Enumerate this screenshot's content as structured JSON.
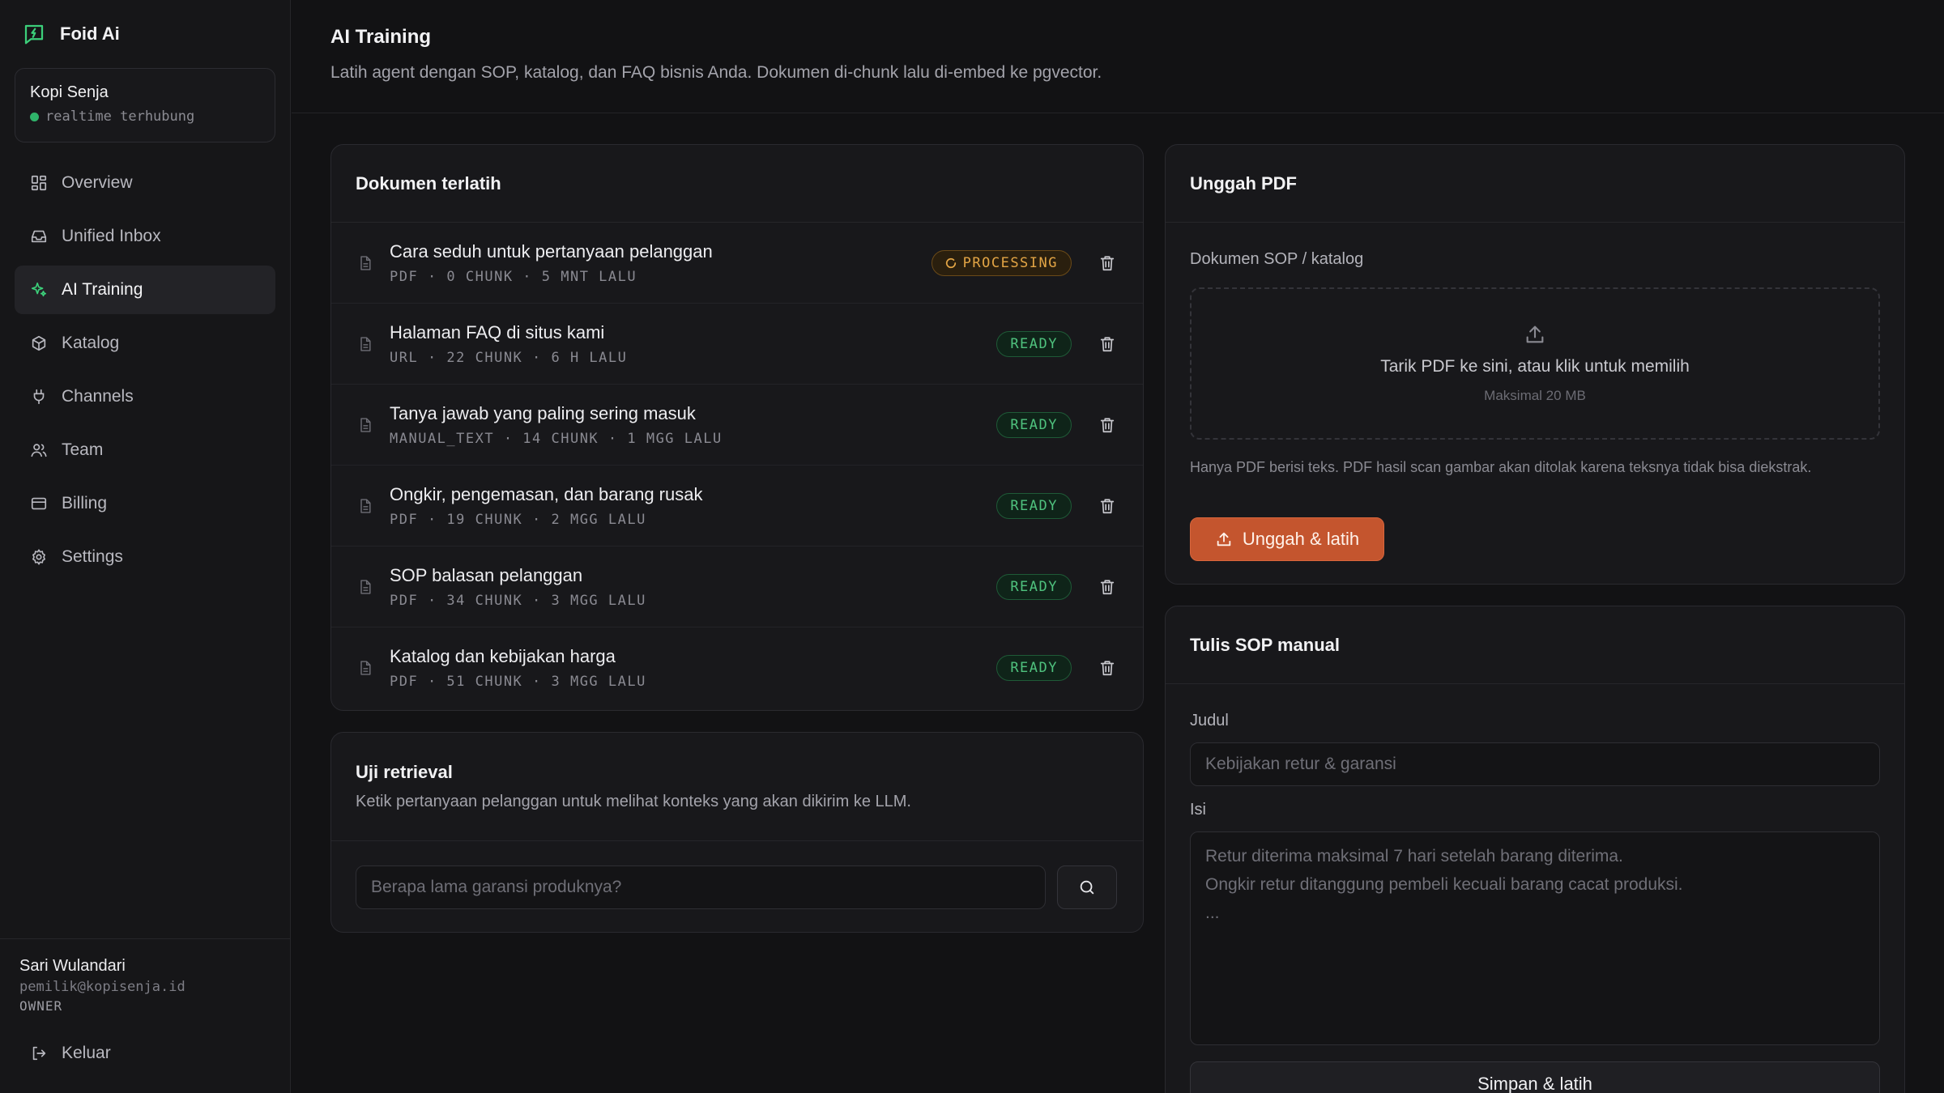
{
  "brand": {
    "name": "Foid Ai"
  },
  "workspace": {
    "name": "Kopi Senja",
    "status": "realtime terhubung",
    "status_color": "#2fb36a"
  },
  "nav": [
    {
      "label": "Overview",
      "icon": "grid-icon",
      "active": false
    },
    {
      "label": "Unified Inbox",
      "icon": "inbox-icon",
      "active": false
    },
    {
      "label": "AI Training",
      "icon": "sparkles-icon",
      "active": true
    },
    {
      "label": "Katalog",
      "icon": "box-icon",
      "active": false
    },
    {
      "label": "Channels",
      "icon": "plug-icon",
      "active": false
    },
    {
      "label": "Team",
      "icon": "users-icon",
      "active": false
    },
    {
      "label": "Billing",
      "icon": "credit-card-icon",
      "active": false
    },
    {
      "label": "Settings",
      "icon": "gear-icon",
      "active": false
    }
  ],
  "user": {
    "name": "Sari Wulandari",
    "email": "pemilik@kopisenja.id",
    "role": "OWNER",
    "logout_label": "Keluar"
  },
  "page": {
    "title": "AI Training",
    "subtitle": "Latih agent dengan SOP, katalog, dan FAQ bisnis Anda. Dokumen di-chunk lalu di-embed ke pgvector."
  },
  "documents": {
    "title": "Dokumen terlatih",
    "items": [
      {
        "title": "Cara seduh untuk pertanyaan pelanggan",
        "meta": "PDF · 0 CHUNK · 5 MNT LALU",
        "status": "PROCESSING"
      },
      {
        "title": "Halaman FAQ di situs kami",
        "meta": "URL · 22 CHUNK · 6 H LALU",
        "status": "READY"
      },
      {
        "title": "Tanya jawab yang paling sering masuk",
        "meta": "MANUAL_TEXT · 14 CHUNK · 1 MGG LALU",
        "status": "READY"
      },
      {
        "title": "Ongkir, pengemasan, dan barang rusak",
        "meta": "PDF · 19 CHUNK · 2 MGG LALU",
        "status": "READY"
      },
      {
        "title": "SOP balasan pelanggan",
        "meta": "PDF · 34 CHUNK · 3 MGG LALU",
        "status": "READY"
      },
      {
        "title": "Katalog dan kebijakan harga",
        "meta": "PDF · 51 CHUNK · 3 MGG LALU",
        "status": "READY"
      }
    ]
  },
  "retrieval": {
    "title": "Uji retrieval",
    "description": "Ketik pertanyaan pelanggan untuk melihat konteks yang akan dikirim ke LLM.",
    "placeholder": "Berapa lama garansi produknya?"
  },
  "upload": {
    "title": "Unggah PDF",
    "field_label": "Dokumen SOP / katalog",
    "drop_main": "Tarik PDF ke sini, atau klik untuk memilih",
    "drop_sub": "Maksimal 20 MB",
    "hint": "Hanya PDF berisi teks. PDF hasil scan gambar akan ditolak karena teksnya tidak bisa diekstrak.",
    "button_label": "Unggah & latih",
    "accent": "#c4552e"
  },
  "manual": {
    "title": "Tulis SOP manual",
    "title_label": "Judul",
    "title_placeholder": "Kebijakan retur & garansi",
    "body_label": "Isi",
    "body_placeholder": "Retur diterima maksimal 7 hari setelah barang diterima.\nOngkir retur ditanggung pembeli kecuali barang cacat produksi.\n...",
    "button_label": "Simpan & latih"
  }
}
